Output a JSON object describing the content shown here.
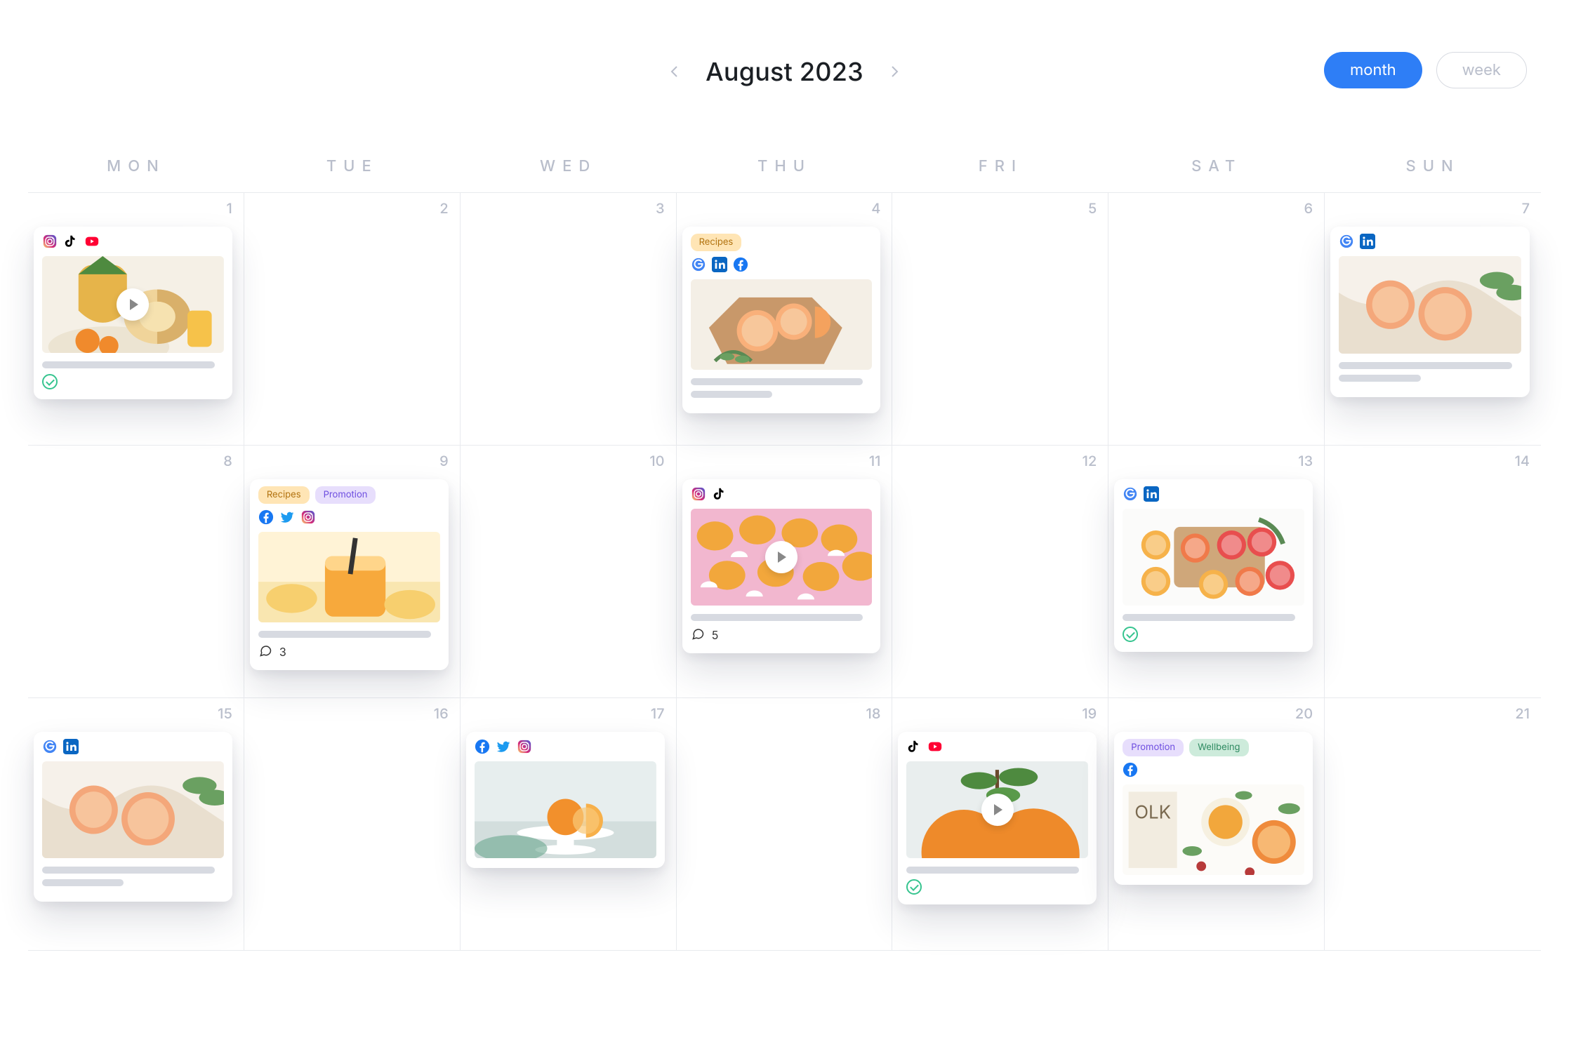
{
  "header": {
    "title": "August 2023",
    "view_month": "month",
    "view_week": "week",
    "active_view": "month"
  },
  "dow": [
    "MON",
    "TUE",
    "WED",
    "THU",
    "FRI",
    "SAT",
    "SUN"
  ],
  "tag_labels": {
    "recipes": "Recipes",
    "promotion": "Promotion",
    "wellbeing": "Wellbeing"
  },
  "cells": [
    {
      "day": 1,
      "card": {
        "platforms": [
          "instagram",
          "tiktok",
          "youtube"
        ],
        "thumb": "pineapple",
        "has_play": true,
        "lines": [
          "long"
        ],
        "approved": true
      }
    },
    {
      "day": 2
    },
    {
      "day": 3
    },
    {
      "day": 4,
      "card": {
        "tags": [
          "recipes"
        ],
        "platforms": [
          "google",
          "linkedin",
          "facebook"
        ],
        "thumb": "grapefruit-board",
        "lines": [
          "long",
          "short"
        ]
      }
    },
    {
      "day": 5
    },
    {
      "day": 6
    },
    {
      "day": 7,
      "card": {
        "platforms": [
          "google",
          "linkedin"
        ],
        "thumb": "grapefruit-drinks",
        "lines": [
          "long",
          "short"
        ]
      }
    },
    {
      "day": 8
    },
    {
      "day": 9,
      "card": {
        "tags": [
          "recipes",
          "promotion"
        ],
        "platforms": [
          "facebook",
          "twitter",
          "instagram"
        ],
        "thumb": "smoothie",
        "lines": [
          "long"
        ],
        "comments": 3
      }
    },
    {
      "day": 10
    },
    {
      "day": 11,
      "card": {
        "platforms": [
          "instagram",
          "tiktok"
        ],
        "thumb": "mango-chips",
        "has_play": true,
        "lines": [
          "long"
        ],
        "comments": 5
      }
    },
    {
      "day": 12
    },
    {
      "day": 13,
      "card": {
        "platforms": [
          "google",
          "linkedin"
        ],
        "thumb": "citrus-slices",
        "lines": [
          "long"
        ],
        "approved": true
      }
    },
    {
      "day": 14
    },
    {
      "day": 15,
      "card": {
        "platforms": [
          "google",
          "linkedin"
        ],
        "thumb": "grapefruit-drinks",
        "lines": [
          "long",
          "short"
        ]
      }
    },
    {
      "day": 16
    },
    {
      "day": 17,
      "card": {
        "platforms": [
          "facebook",
          "twitter",
          "instagram"
        ],
        "thumb": "orange-stand",
        "lines": []
      }
    },
    {
      "day": 18
    },
    {
      "day": 19,
      "card": {
        "platforms": [
          "tiktok",
          "youtube"
        ],
        "thumb": "oranges-branch",
        "has_play": true,
        "lines": [
          "long"
        ],
        "approved": true
      }
    },
    {
      "day": 20,
      "card": {
        "tags": [
          "promotion",
          "wellbeing"
        ],
        "platforms": [
          "facebook"
        ],
        "thumb": "flatlay-juice",
        "lines": []
      }
    },
    {
      "day": 21
    }
  ]
}
